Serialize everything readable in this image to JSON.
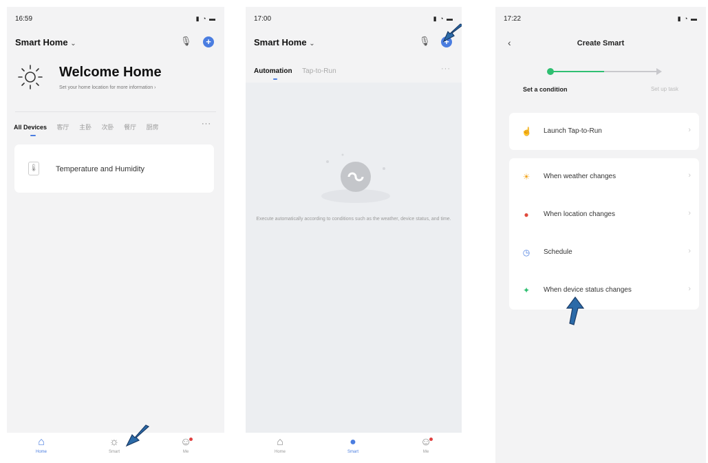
{
  "phone1": {
    "time": "16:59",
    "home_name": "Smart Home",
    "welcome_title": "Welcome Home",
    "welcome_sub": "Set your home location for more information",
    "room_tabs": [
      "All Devices",
      "客厅",
      "主卧",
      "次卧",
      "餐厅",
      "厨房"
    ],
    "device_name": "Temperature and Humidity",
    "tabbar": [
      "Home",
      "Smart",
      "Me"
    ]
  },
  "phone2": {
    "time": "17:00",
    "home_name": "Smart Home",
    "tab_automation": "Automation",
    "tab_taptorun": "Tap-to-Run",
    "empty_text": "Execute automatically according to conditions such as the weather, device status, and time.",
    "tabbar": [
      "Home",
      "Smart",
      "Me"
    ]
  },
  "phone3": {
    "time": "17:22",
    "title": "Create Smart",
    "step1": "Set a condition",
    "step2": "Set up task",
    "launch": "Launch Tap-to-Run",
    "conditions": [
      "When weather changes",
      "When location changes",
      "Schedule",
      "When device status changes"
    ]
  },
  "colors": {
    "accent": "#4a7de0",
    "step_green": "#2fbf71",
    "arrow": "#2b6aa8"
  },
  "icons": {
    "sun": "sun-icon",
    "mic": "mic-icon",
    "plus": "plus-icon",
    "thermometer": "thermometer-icon",
    "home": "home-icon",
    "smart": "smart-icon",
    "me": "me-icon",
    "link": "link-icon",
    "hand": "hand-icon",
    "weather": "weather-icon",
    "location": "location-icon",
    "clock": "clock-icon",
    "device": "device-icon",
    "back": "back-icon",
    "chevron": "chevron-right-icon"
  }
}
